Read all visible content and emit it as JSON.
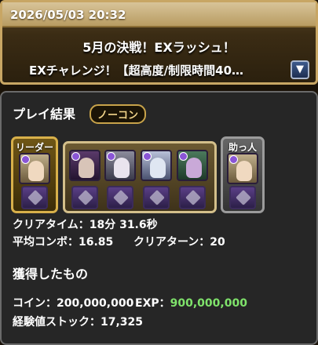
{
  "header": {
    "date": "2026/05/03 20:32",
    "title": "5月の決戦！EXラッシュ！",
    "subtitle": "EXチャレンジ！【超高度/制限時間40…"
  },
  "result": {
    "section_title": "プレイ結果",
    "badge": "ノーコン",
    "leader_label": "リーダー",
    "helper_label": "助っ人",
    "clear_time": "クリアタイム：18分 31.6秒",
    "avg_combo": "平均コンボ：16.85",
    "clear_turn": "クリアターン：20"
  },
  "rewards": {
    "section_title": "獲得したもの",
    "coin": "コイン：200,000,000",
    "exp_label": "EXP：",
    "exp_value": "900,000,000",
    "exp_stock": "経験値ストック：17,325"
  },
  "colors": {
    "exp_green": "#7fe36b",
    "gold_border": "#d8b04a",
    "badge_text": "#f2d58a"
  }
}
